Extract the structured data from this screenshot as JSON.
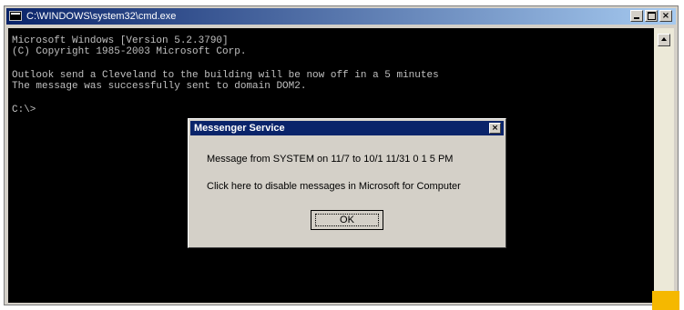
{
  "window": {
    "title": "C:\\WINDOWS\\system32\\cmd.exe",
    "min_icon": "minimize-icon",
    "max_icon": "maximize-icon",
    "close_label": "×"
  },
  "console": {
    "lines": [
      "Microsoft Windows [Version 5.2.3790]",
      "(C) Copyright 1985-2003 Microsoft Corp.",
      "Outlook send a Cleveland to the building will be now off in a 5 minutes",
      "The message was successfully sent to domain DOM2.",
      "C:\\>"
    ]
  },
  "dialog": {
    "title": "Messenger Service",
    "close_label": "×",
    "line1": "Message from SYSTEM on 11/7 to 10/1 11/31 0 1 5 PM",
    "line2": "Click here to disable messages in Microsoft for Computer",
    "ok_label": "OK"
  },
  "colors": {
    "titlebar": "#0a246a",
    "console_bg": "#000000",
    "console_text": "#c0c0c0",
    "dialog_bg": "#d4d0c8",
    "scroll_accent": "#f5b800"
  }
}
